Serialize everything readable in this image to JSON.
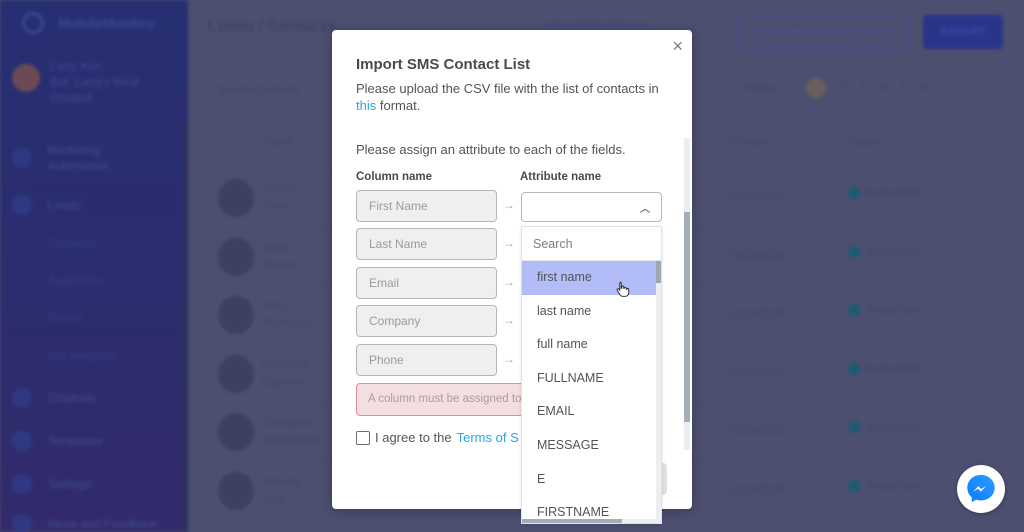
{
  "app": {
    "brand": "MobileMonkey",
    "user": {
      "name": "Larry Kim",
      "subtitle": "Bot: Larry's Real Chatbot"
    },
    "sidebar": {
      "items": [
        {
          "label": "Marketing Automation",
          "icon": "rocket-icon"
        },
        {
          "label": "Leads",
          "icon": "people-icon"
        },
        {
          "label": "Contacts",
          "sub": true
        },
        {
          "label": "Audiences",
          "sub": true
        },
        {
          "label": "Forms",
          "sub": true
        },
        {
          "label": "Bot Analytics",
          "sub": true
        },
        {
          "label": "Chatbots",
          "icon": "bot-icon"
        },
        {
          "label": "Templates",
          "icon": "template-icon"
        },
        {
          "label": "Settings",
          "icon": "gear-icon"
        },
        {
          "label": "Ideas and Feedback",
          "icon": "bulb-icon"
        }
      ]
    },
    "header": {
      "title": "Leads / Contacts",
      "import_link": "Import SMS Contacts",
      "attributes_button": "ATTRIBUTES AND TAGS",
      "export_button": "EXPORT"
    },
    "search_placeholder": "Search Contacts",
    "pager": {
      "label": "Pages",
      "pages": [
        "1",
        "2",
        "3",
        "4",
        "5",
        "6",
        "7"
      ],
      "current": "1"
    },
    "table": {
      "columns": [
        "Name",
        "Created",
        "Status"
      ],
      "rows": [
        {
          "name": "Amelie Tuner",
          "created": "02/25/2020",
          "status": "Subscribed"
        },
        {
          "name": "Steve Dorsey",
          "created": "02/25/2020",
          "status": "Subscribed"
        },
        {
          "name": "Andy Thomas Jr.",
          "created": "02/24/2020",
          "status": "Subscribed"
        },
        {
          "name": "Mary Ann Egleston",
          "created": "02/24/2020",
          "status": "Subscribed"
        },
        {
          "name": "Changhai Wonsowsky",
          "created": "02/24/2020",
          "status": "Subscribed"
        },
        {
          "name": "Melanie Jolly",
          "created": "02/24/2020",
          "status": "Subscribed"
        }
      ]
    }
  },
  "modal": {
    "title": "Import SMS Contact List",
    "intro_before": "Please upload the CSV file with the list of contacts in ",
    "intro_link": "this",
    "intro_after": " format.",
    "assign_text": "Please assign an attribute to each of the fields.",
    "column_header": "Column name",
    "attribute_header": "Attribute name",
    "columns": [
      "First Name",
      "Last Name",
      "Email",
      "Company",
      "Phone"
    ],
    "arrow": "→",
    "attribute_select_value": "",
    "error_text": "A column must be assigned to",
    "agree_before": "I agree to the ",
    "agree_link": "Terms of S",
    "close_label": "×"
  },
  "dropdown": {
    "search_placeholder": "Search",
    "options": [
      "first name",
      "last name",
      "full name",
      "FULLNAME",
      "EMAIL",
      "MESSAGE",
      "E",
      "FIRSTNAME"
    ],
    "highlighted": "first name"
  },
  "colors": {
    "accent_link": "#2aa7db",
    "highlight": "#b2bdf7",
    "error_bg": "#f3dfe1",
    "error_border": "#e48a95",
    "messenger_blue": "#0a7cff"
  }
}
